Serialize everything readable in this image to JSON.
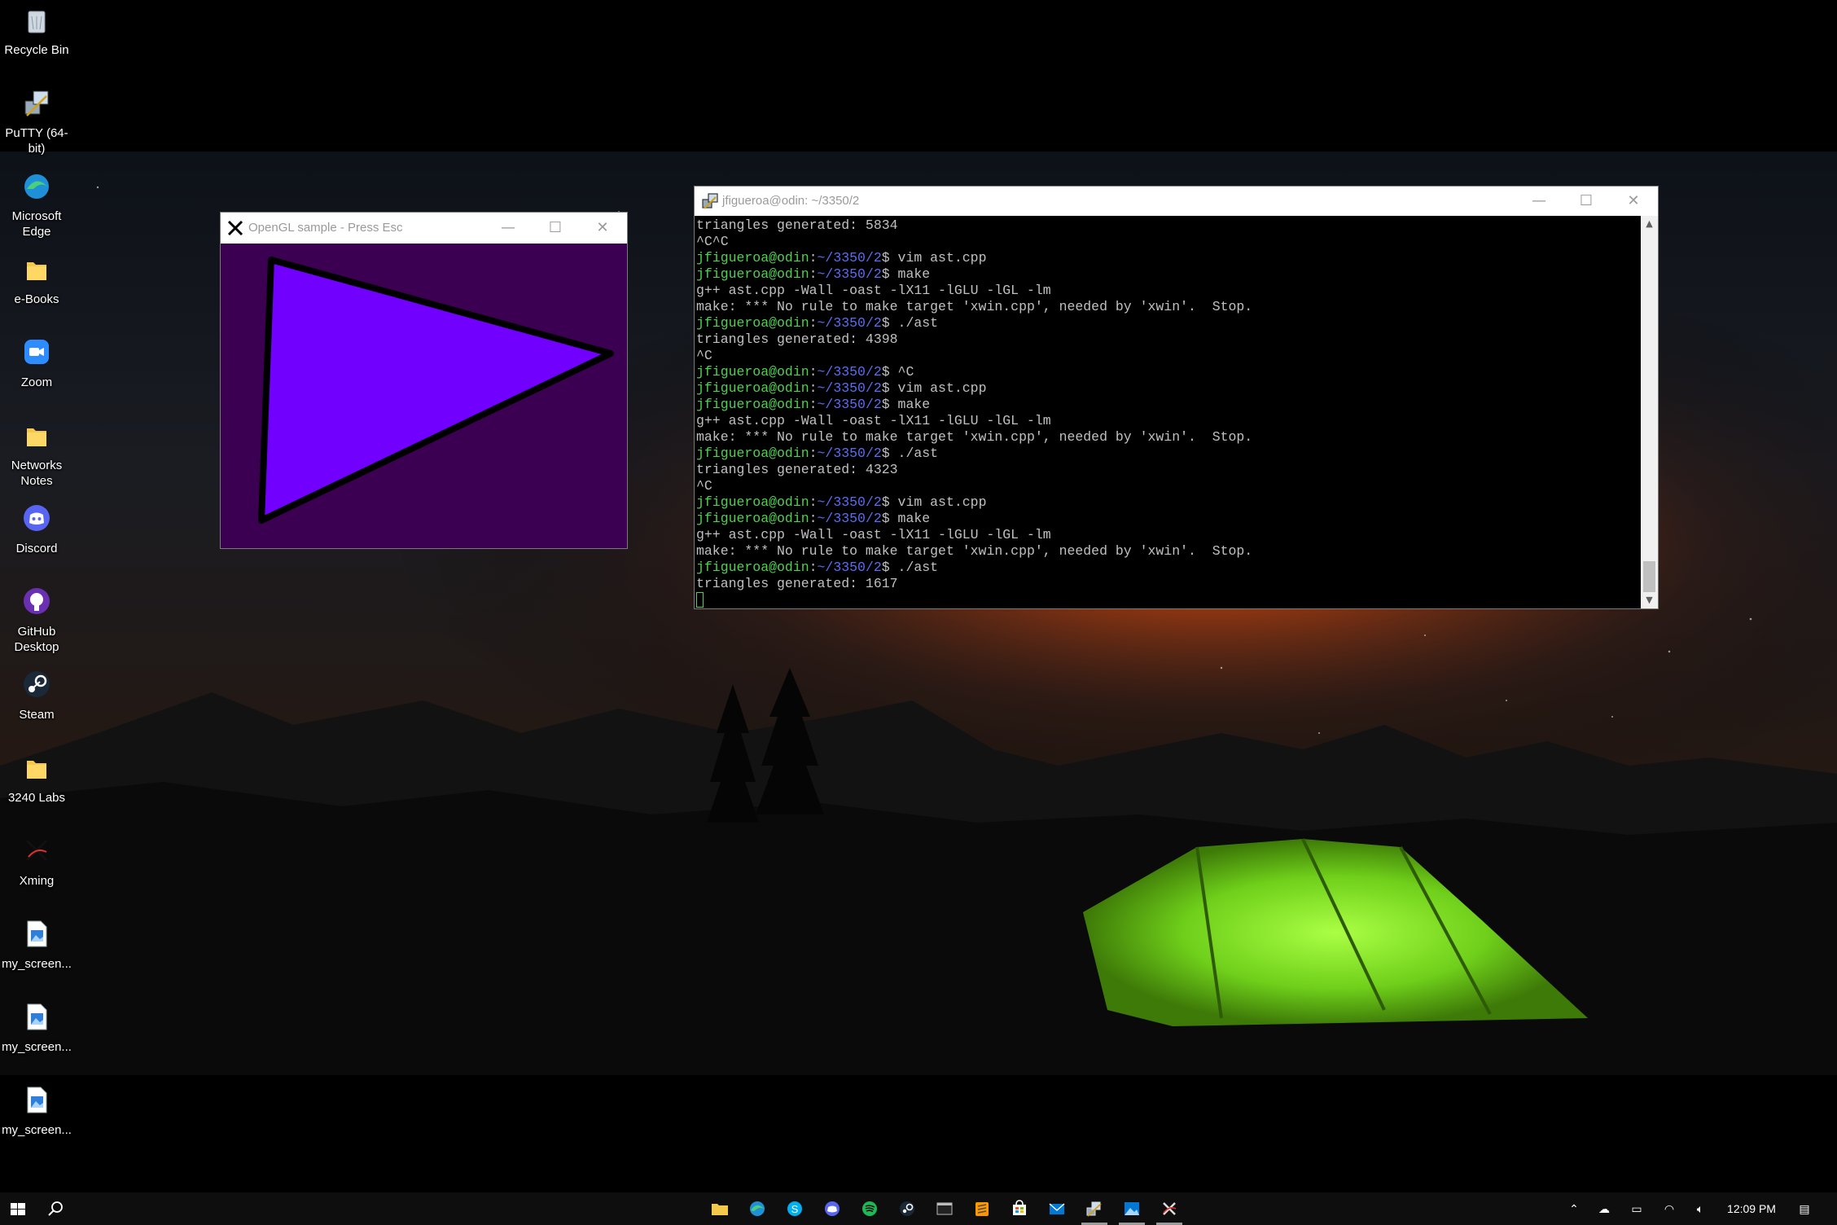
{
  "desktop": {
    "icons": [
      {
        "label": "Recycle Bin",
        "icon": "recycle-bin-icon"
      },
      {
        "label": "PuTTY (64-bit)",
        "icon": "putty-icon"
      },
      {
        "label": "Microsoft Edge",
        "icon": "edge-icon"
      },
      {
        "label": "e-Books",
        "icon": "folder-icon"
      },
      {
        "label": "Zoom",
        "icon": "zoom-icon"
      },
      {
        "label": "Networks Notes",
        "icon": "folder-icon"
      },
      {
        "label": "Discord",
        "icon": "discord-icon"
      },
      {
        "label": "GitHub Desktop",
        "icon": "github-desktop-icon"
      },
      {
        "label": "Steam",
        "icon": "steam-icon"
      },
      {
        "label": "3240 Labs",
        "icon": "folder-icon"
      },
      {
        "label": "Xming",
        "icon": "xming-icon"
      },
      {
        "label": "my_screen...",
        "icon": "image-file-icon"
      },
      {
        "label": "my_screen...",
        "icon": "image-file-icon"
      },
      {
        "label": "my_screen...",
        "icon": "image-file-icon"
      }
    ]
  },
  "gl_window": {
    "title": "OpenGL sample  -  Press Esc",
    "minimize": "—",
    "maximize": "☐",
    "close": "✕",
    "background_color": "#3b0051",
    "triangle_fill": "#7200ff",
    "triangle_stroke": "#000000"
  },
  "terminal": {
    "title": "jfigueroa@odin: ~/3350/2",
    "minimize": "—",
    "maximize": "☐",
    "close": "✕",
    "user": "jfigueroa@odin",
    "path": "~/3350/2",
    "lines": [
      {
        "prompt": false,
        "text": "triangles generated: 5834"
      },
      {
        "prompt": false,
        "text": "^C^C"
      },
      {
        "prompt": true,
        "text": "$ vim ast.cpp"
      },
      {
        "prompt": true,
        "text": "$ make"
      },
      {
        "prompt": false,
        "text": "g++ ast.cpp -Wall -oast -lX11 -lGLU -lGL -lm"
      },
      {
        "prompt": false,
        "text": "make: *** No rule to make target 'xwin.cpp', needed by 'xwin'.  Stop."
      },
      {
        "prompt": true,
        "text": "$ ./ast"
      },
      {
        "prompt": false,
        "text": "triangles generated: 4398"
      },
      {
        "prompt": false,
        "text": "^C"
      },
      {
        "prompt": true,
        "text": "$ ^C"
      },
      {
        "prompt": true,
        "text": "$ vim ast.cpp"
      },
      {
        "prompt": true,
        "text": "$ make"
      },
      {
        "prompt": false,
        "text": "g++ ast.cpp -Wall -oast -lX11 -lGLU -lGL -lm"
      },
      {
        "prompt": false,
        "text": "make: *** No rule to make target 'xwin.cpp', needed by 'xwin'.  Stop."
      },
      {
        "prompt": true,
        "text": "$ ./ast"
      },
      {
        "prompt": false,
        "text": "triangles generated: 4323"
      },
      {
        "prompt": false,
        "text": "^C"
      },
      {
        "prompt": true,
        "text": "$ vim ast.cpp"
      },
      {
        "prompt": true,
        "text": "$ make"
      },
      {
        "prompt": false,
        "text": "g++ ast.cpp -Wall -oast -lX11 -lGLU -lGL -lm"
      },
      {
        "prompt": false,
        "text": "make: *** No rule to make target 'xwin.cpp', needed by 'xwin'.  Stop."
      },
      {
        "prompt": true,
        "text": "$ ./ast"
      },
      {
        "prompt": false,
        "text": "triangles generated: 1617"
      }
    ],
    "colors": {
      "user": "#4fd14f",
      "path": "#5a6cf0",
      "text": "#c0c0c0"
    }
  },
  "taskbar": {
    "pinned": [
      "file-explorer-icon",
      "edge-icon",
      "skype-icon",
      "discord-icon",
      "spotify-icon",
      "steam-icon",
      "terminal-icon",
      "sublime-text-icon",
      "store-icon",
      "mail-icon",
      "putty-icon",
      "photos-icon",
      "xming-icon"
    ],
    "clock": "12:09 PM"
  }
}
